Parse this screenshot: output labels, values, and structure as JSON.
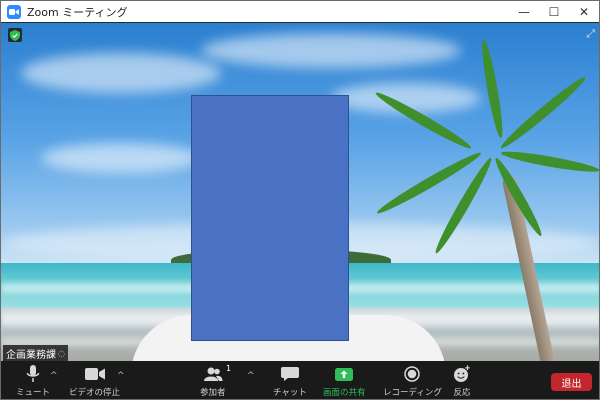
{
  "window": {
    "title": "Zoom ミーティング",
    "controls": {
      "minimize": "—",
      "maximize": "☐",
      "close": "✕"
    }
  },
  "video": {
    "participant_name": "企画業務課",
    "background": "tropical-beach-virtual-background"
  },
  "toolbar": {
    "mute_label": "ミュート",
    "stop_video_label": "ビデオの停止",
    "participants_label": "参加者",
    "participants_count": "1",
    "chat_label": "チャット",
    "share_screen_label": "画面の共有",
    "record_label": "レコーディング",
    "reactions_label": "反応",
    "leave_label": "退出"
  },
  "colors": {
    "toolbar_bg": "#1a1a1a",
    "share_green": "#2ebd59",
    "leave_red": "#c2272d",
    "zoom_blue": "#2d8cff",
    "face_block": "#4a72c4"
  }
}
